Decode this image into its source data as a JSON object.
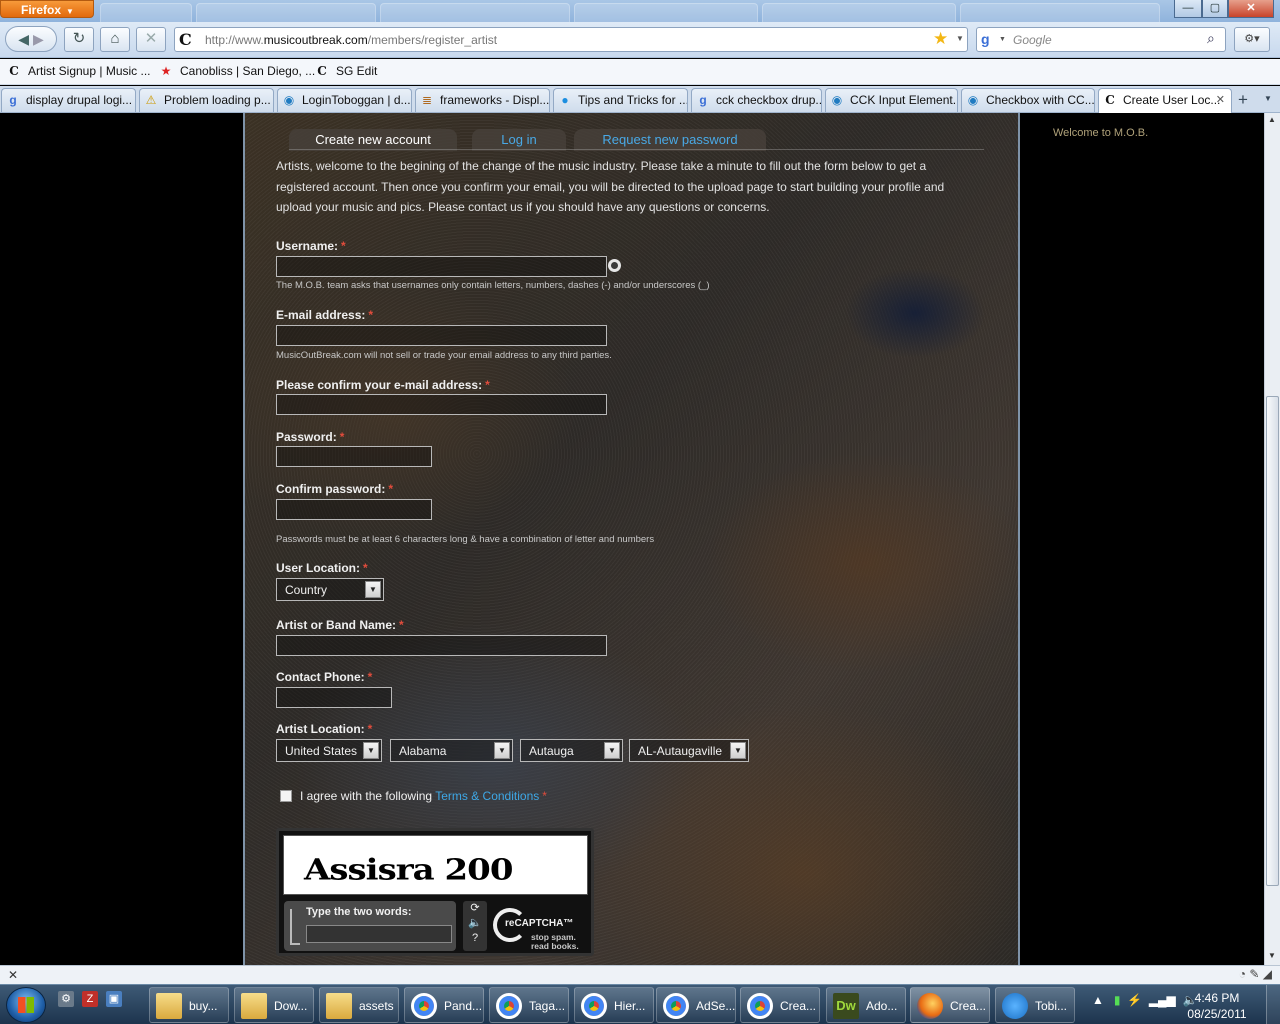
{
  "browser": {
    "menu_button": "Firefox",
    "url_prefix": "http://www.",
    "url_domain": "musicoutbreak.com",
    "url_path": "/members/register_artist",
    "search_placeholder": "Google",
    "window_controls": {
      "minimize": "—",
      "maximize": "▢",
      "close": "✕"
    }
  },
  "bookmarks": [
    {
      "label": "Artist Signup | Music ...",
      "icon": "C"
    },
    {
      "label": "Canobliss | San Diego, ...",
      "icon": "★"
    },
    {
      "label": "SG Edit",
      "icon": "C"
    }
  ],
  "tabs": [
    {
      "label": "display drupal logi...",
      "icon": "g"
    },
    {
      "label": "Problem loading p...",
      "icon": "⚠"
    },
    {
      "label": "LoginToboggan | d...",
      "icon": "◉"
    },
    {
      "label": "frameworks - Displ...",
      "icon": "≣"
    },
    {
      "label": "Tips and Tricks for ...",
      "icon": "●"
    },
    {
      "label": "cck checkbox drup...",
      "icon": "g"
    },
    {
      "label": "CCK Input Element...",
      "icon": "◉"
    },
    {
      "label": "Checkbox with CC...",
      "icon": "◉"
    },
    {
      "label": "Create User Loc...",
      "icon": "C",
      "active": true
    }
  ],
  "page_tabs": {
    "create": "Create new account",
    "login": "Log in",
    "request": "Request new password"
  },
  "intro": "Artists, welcome to the begining of the change of the music industry. Please take a minute to fill out the form below to get a registered account. Then once you confirm your email, you will be directed to the upload page to start building your profile and upload your music and pics. Please contact us if you should have any questions or concerns.",
  "form": {
    "required_mark": "*",
    "username_label": "Username:",
    "username_desc": "The M.O.B. team asks that usernames only contain letters, numbers, dashes (-) and/or underscores (_)",
    "email_label": "E-mail address:",
    "email_desc": "MusicOutBreak.com will not sell or trade your email address to any third parties.",
    "confirm_email_label": "Please confirm your e-mail address:",
    "password_label": "Password:",
    "confirm_password_label": "Confirm password:",
    "password_desc": "Passwords must be at least 6 characters long & have a combination of letter and numbers",
    "user_location_label": "User Location:",
    "user_location_value": "Country",
    "artist_name_label": "Artist or Band Name:",
    "phone_label": "Contact Phone:",
    "artist_location_label": "Artist Location:",
    "artist_location": {
      "country": "United States",
      "state": "Alabama",
      "county": "Autauga",
      "city": "AL-Autaugaville"
    },
    "agree_text": "I agree with the following ",
    "terms_link": "Terms & Conditions"
  },
  "captcha": {
    "words": "Assisra 200",
    "prompt": "Type the two words:",
    "brand": "reCAPTCHA™",
    "tagline1": "stop spam.",
    "tagline2": "read books."
  },
  "sidebar": {
    "welcome": "Welcome to M.O.B."
  },
  "taskbar": {
    "items": [
      {
        "label": "buy...",
        "kind": "folder"
      },
      {
        "label": "Dow...",
        "kind": "folder"
      },
      {
        "label": "assets",
        "kind": "folder"
      },
      {
        "label": "Pand...",
        "kind": "chrome"
      },
      {
        "label": "Taga...",
        "kind": "chrome"
      },
      {
        "label": "Hier...",
        "kind": "chrome"
      },
      {
        "label": "AdSe...",
        "kind": "chrome"
      },
      {
        "label": "Crea...",
        "kind": "chrome"
      },
      {
        "label": "Ado...",
        "kind": "dw"
      },
      {
        "label": "Crea...",
        "kind": "ff"
      },
      {
        "label": "Tobi...",
        "kind": "chat"
      }
    ],
    "time": "4:46 PM",
    "date": "08/25/2011"
  }
}
